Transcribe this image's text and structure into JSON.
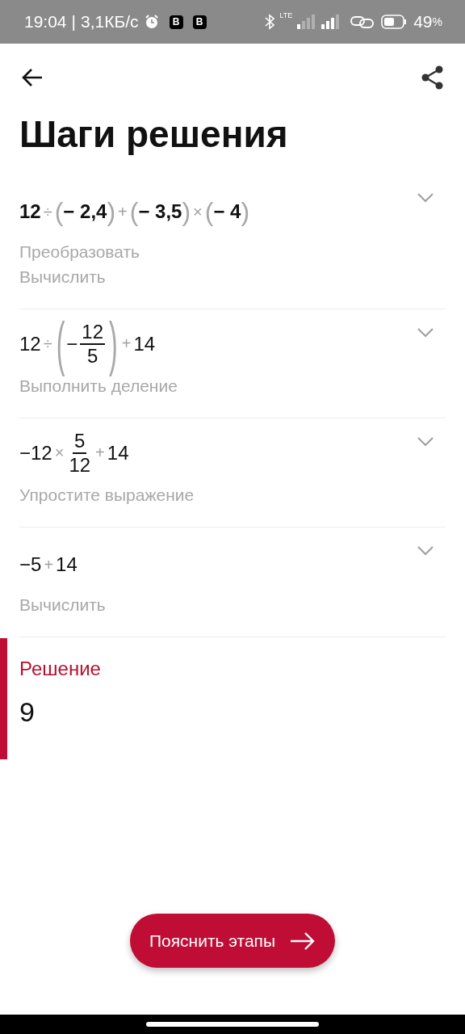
{
  "status_bar": {
    "time": "19:04",
    "separator": "|",
    "speed": "3,1КБ/с",
    "badges": [
      "B",
      "B"
    ],
    "network": "LTE",
    "battery_percent": "49",
    "battery_unit": "%"
  },
  "header": {
    "title": "Шаги решения"
  },
  "steps": [
    {
      "bold": true,
      "expression": [
        {
          "kind": "num",
          "text": "12"
        },
        {
          "kind": "op",
          "text": "÷"
        },
        {
          "kind": "paren",
          "text": "("
        },
        {
          "kind": "num",
          "text": "− 2,4"
        },
        {
          "kind": "paren",
          "text": ")"
        },
        {
          "kind": "op",
          "text": "+"
        },
        {
          "kind": "paren",
          "text": "("
        },
        {
          "kind": "num",
          "text": "− 3,5"
        },
        {
          "kind": "paren",
          "text": ")"
        },
        {
          "kind": "op",
          "text": "×"
        },
        {
          "kind": "paren",
          "text": "("
        },
        {
          "kind": "num",
          "text": "− 4"
        },
        {
          "kind": "paren",
          "text": ")"
        }
      ],
      "descriptions": [
        "Преобразовать",
        "Вычислить"
      ]
    },
    {
      "bold": false,
      "expression": [
        {
          "kind": "num",
          "text": "12"
        },
        {
          "kind": "op",
          "text": "÷"
        },
        {
          "kind": "paren",
          "text": "("
        },
        {
          "kind": "num",
          "text": "−"
        },
        {
          "kind": "frac",
          "num": "12",
          "den": "5"
        },
        {
          "kind": "paren",
          "text": ")"
        },
        {
          "kind": "op",
          "text": "+"
        },
        {
          "kind": "num",
          "text": "14"
        }
      ],
      "descriptions": [
        "Выполнить деление"
      ]
    },
    {
      "bold": false,
      "expression": [
        {
          "kind": "num",
          "text": "−12"
        },
        {
          "kind": "op",
          "text": "×"
        },
        {
          "kind": "frac",
          "num": "5",
          "den": "12"
        },
        {
          "kind": "op",
          "text": "+"
        },
        {
          "kind": "num",
          "text": "14"
        }
      ],
      "descriptions": [
        "Упростите выражение"
      ]
    },
    {
      "bold": false,
      "expression": [
        {
          "kind": "num",
          "text": "−5"
        },
        {
          "kind": "op",
          "text": "+"
        },
        {
          "kind": "num",
          "text": "14"
        }
      ],
      "descriptions": [
        "Вычислить"
      ]
    }
  ],
  "solution": {
    "label": "Решение",
    "value": "9"
  },
  "action_button": {
    "label": "Пояснить этапы"
  }
}
